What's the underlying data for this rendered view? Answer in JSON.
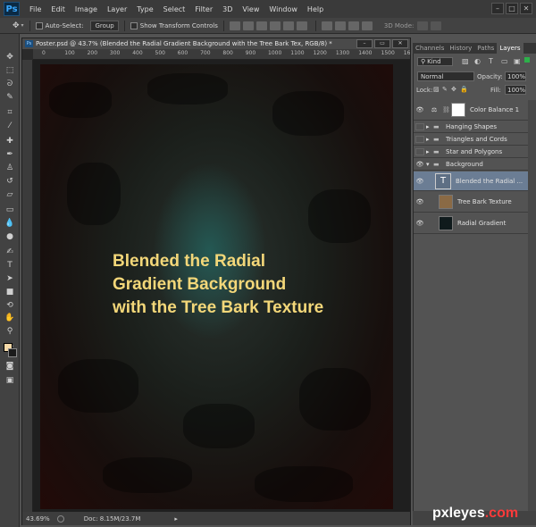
{
  "app": {
    "logo": "Ps"
  },
  "menu": [
    "File",
    "Edit",
    "Image",
    "Layer",
    "Type",
    "Select",
    "Filter",
    "3D",
    "View",
    "Window",
    "Help"
  ],
  "window_controls": {
    "minimize": "–",
    "maximize": "□",
    "close": "✕"
  },
  "options_bar": {
    "auto_select_label": "Auto-Select:",
    "auto_select_value": "Group",
    "transform_controls_label": "Show Transform Controls",
    "mode_3d_label": "3D Mode:"
  },
  "document": {
    "title": "Poster.psd @ 43.7% (Blended the Radial  Gradient Background  with the Tree Bark Tex, RGB/8) *",
    "ruler_ticks": [
      "0",
      "100",
      "200",
      "300",
      "400",
      "500",
      "600",
      "700",
      "800",
      "900",
      "1000",
      "1100",
      "1200",
      "1300",
      "1400",
      "1500",
      "1600"
    ],
    "canvas_text": [
      "Blended the Radial",
      "Gradient Background",
      "with the Tree Bark Texture"
    ],
    "status_zoom": "43.69%",
    "status_doc": "Doc: 8.15M/23.7M"
  },
  "panels": {
    "tabs": [
      "Channels",
      "History",
      "Paths",
      "Layers"
    ],
    "active_tab": "Layers",
    "kind_label": "Kind",
    "blend_mode": "Normal",
    "opacity_label": "Opacity:",
    "opacity_value": "100%",
    "lock_label": "Lock:",
    "fill_label": "Fill:",
    "fill_value": "100%",
    "layers": [
      {
        "name": "Color Balance 1",
        "type": "adjustment"
      },
      {
        "name": "Hanging Shapes",
        "type": "group"
      },
      {
        "name": "Triangles and Cords",
        "type": "group"
      },
      {
        "name": "Star and Polygons",
        "type": "group"
      },
      {
        "name": "Background",
        "type": "group-open"
      },
      {
        "name": "Blended the Radial ...",
        "type": "text",
        "selected": true
      },
      {
        "name": "Tree Bark Texture",
        "type": "image"
      },
      {
        "name": "Radial Gradient",
        "type": "image"
      }
    ]
  },
  "watermark": {
    "brand": "pxleyes",
    "tld": ".com"
  },
  "colors": {
    "text_highlight": "#f3d779",
    "selected_layer": "#6b7d94",
    "ps_blue": "#39a8ff"
  }
}
